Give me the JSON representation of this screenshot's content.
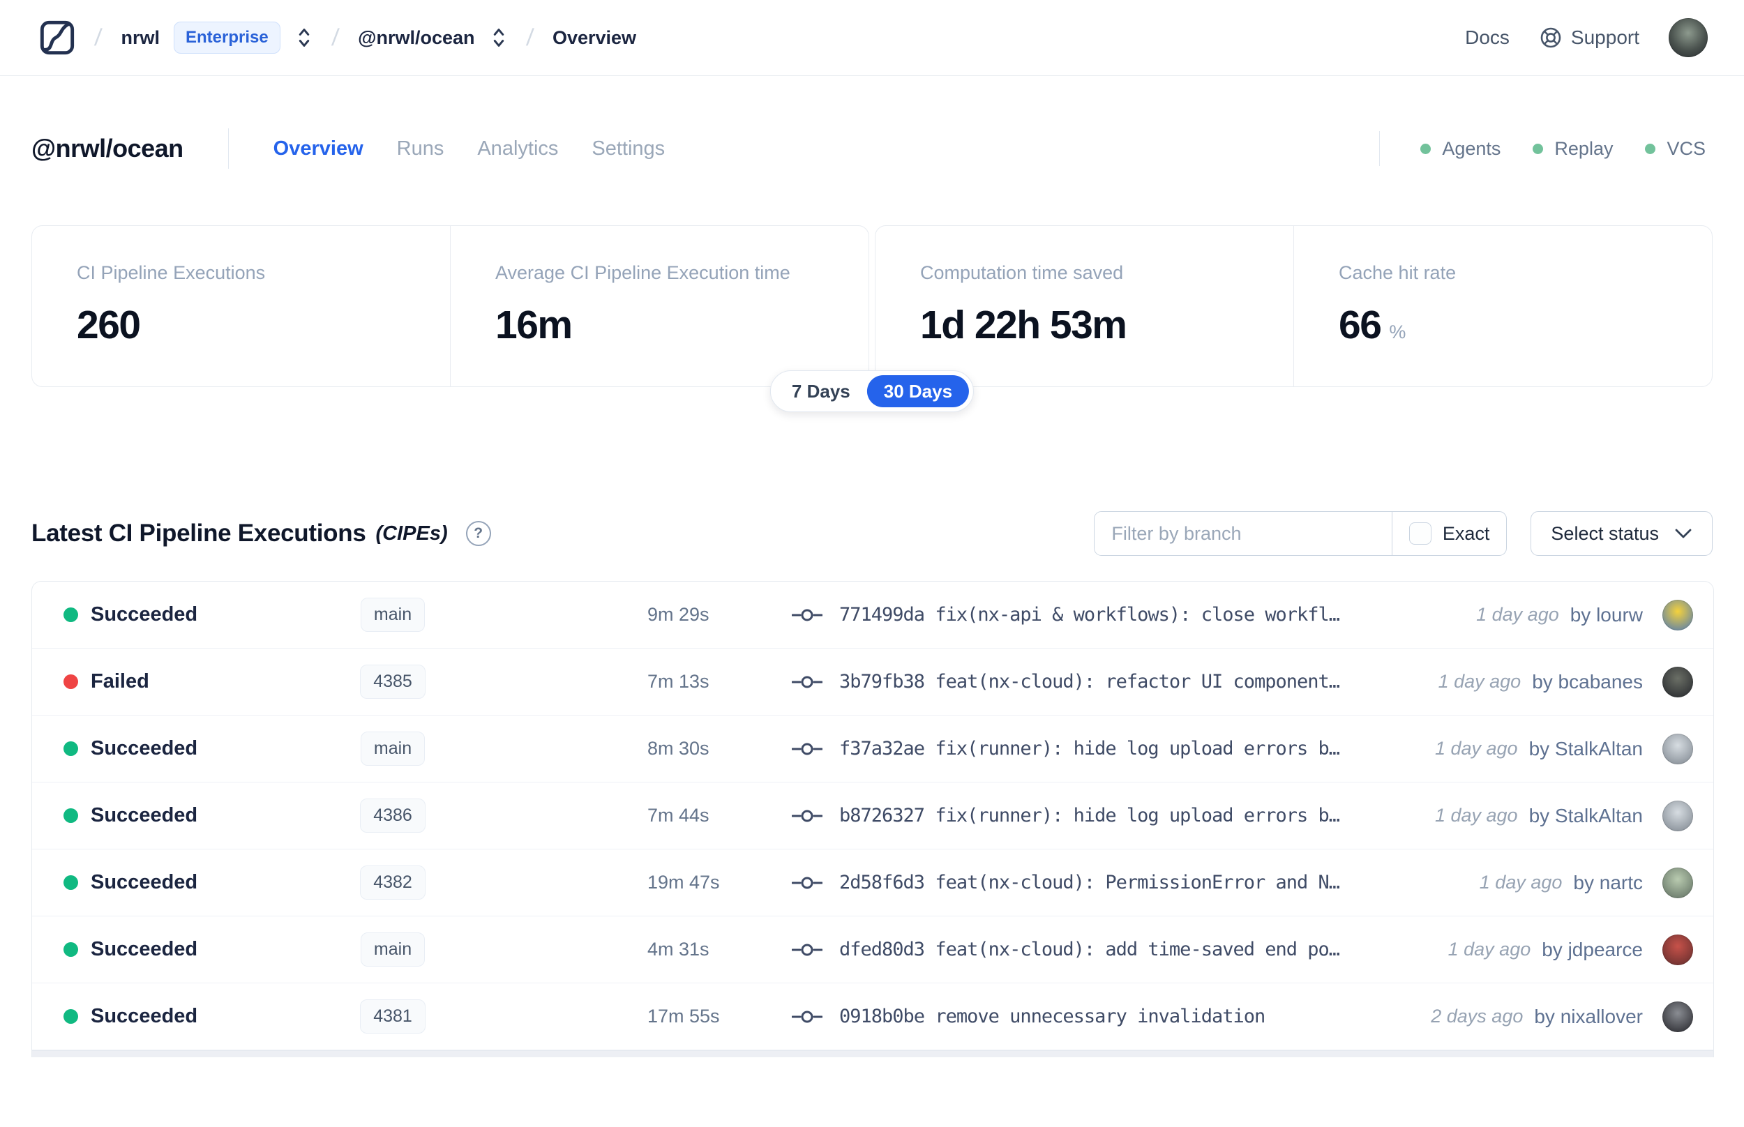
{
  "nav": {
    "breadcrumb": {
      "org": "nrwl",
      "org_badge": "Enterprise",
      "workspace": "@nrwl/ocean",
      "page": "Overview"
    },
    "docs_label": "Docs",
    "support_label": "Support"
  },
  "workspace_header": {
    "title": "@nrwl/ocean",
    "tabs": [
      {
        "label": "Overview",
        "active": true
      },
      {
        "label": "Runs",
        "active": false
      },
      {
        "label": "Analytics",
        "active": false
      },
      {
        "label": "Settings",
        "active": false
      }
    ],
    "integrations": [
      {
        "label": "Agents"
      },
      {
        "label": "Replay"
      },
      {
        "label": "VCS"
      }
    ]
  },
  "stats": {
    "cards": [
      {
        "label": "CI Pipeline Executions",
        "value": "260",
        "suffix": ""
      },
      {
        "label": "Average CI Pipeline Execution time",
        "value": "16m",
        "suffix": ""
      },
      {
        "label": "Computation time saved",
        "value": "1d 22h 53m",
        "suffix": ""
      },
      {
        "label": "Cache hit rate",
        "value": "66",
        "suffix": "%"
      }
    ],
    "range_toggle": {
      "options": [
        "7 Days",
        "30 Days"
      ],
      "selected": "30 Days"
    }
  },
  "cipe_section": {
    "title": "Latest CI Pipeline Executions",
    "subtitle": "(CIPEs)",
    "help_glyph": "?",
    "filter": {
      "placeholder": "Filter by branch",
      "exact_label": "Exact",
      "exact_checked": false
    },
    "status_select_label": "Select status"
  },
  "table": {
    "rows": [
      {
        "status": "Succeeded",
        "branch": "main",
        "duration": "9m 29s",
        "commit_hash": "771499da",
        "commit_message": "fix(nx-api & workflows): close workfl…",
        "time": "1 day ago",
        "author_label": "by lourw",
        "avatar_colors": [
          "#f5d23c",
          "#4a76b8"
        ]
      },
      {
        "status": "Failed",
        "branch": "4385",
        "duration": "7m 13s",
        "commit_hash": "3b79fb38",
        "commit_message": "feat(nx-cloud): refactor UI component…",
        "time": "1 day ago",
        "author_label": "by bcabanes",
        "avatar_colors": [
          "#6b6f66",
          "#23252a"
        ]
      },
      {
        "status": "Succeeded",
        "branch": "main",
        "duration": "8m 30s",
        "commit_hash": "f37a32ae",
        "commit_message": "fix(runner): hide log upload errors b…",
        "time": "1 day ago",
        "author_label": "by StalkAltan",
        "avatar_colors": [
          "#d7dde2",
          "#7b838c"
        ]
      },
      {
        "status": "Succeeded",
        "branch": "4386",
        "duration": "7m 44s",
        "commit_hash": "b8726327",
        "commit_message": "fix(runner): hide log upload errors b…",
        "time": "1 day ago",
        "author_label": "by StalkAltan",
        "avatar_colors": [
          "#d7dde2",
          "#7b838c"
        ]
      },
      {
        "status": "Succeeded",
        "branch": "4382",
        "duration": "19m 47s",
        "commit_hash": "2d58f6d3",
        "commit_message": "feat(nx-cloud): PermissionError and N…",
        "time": "1 day ago",
        "author_label": "by nartc",
        "avatar_colors": [
          "#b9cbb0",
          "#5c6b5e"
        ]
      },
      {
        "status": "Succeeded",
        "branch": "main",
        "duration": "4m 31s",
        "commit_hash": "dfed80d3",
        "commit_message": "feat(nx-cloud): add time-saved end po…",
        "time": "1 day ago",
        "author_label": "by jdpearce",
        "avatar_colors": [
          "#c7524a",
          "#5d2b2b"
        ]
      },
      {
        "status": "Succeeded",
        "branch": "4381",
        "duration": "17m 55s",
        "commit_hash": "0918b0be",
        "commit_message": "remove unnecessary invalidation",
        "time": "2 days ago",
        "author_label": "by nixallover",
        "avatar_colors": [
          "#8a8d93",
          "#222227"
        ]
      }
    ]
  },
  "colors": {
    "accent_blue": "#2563eb",
    "success_green": "#10b981",
    "failed_red": "#ef4444",
    "integration_green": "#72c29b"
  }
}
